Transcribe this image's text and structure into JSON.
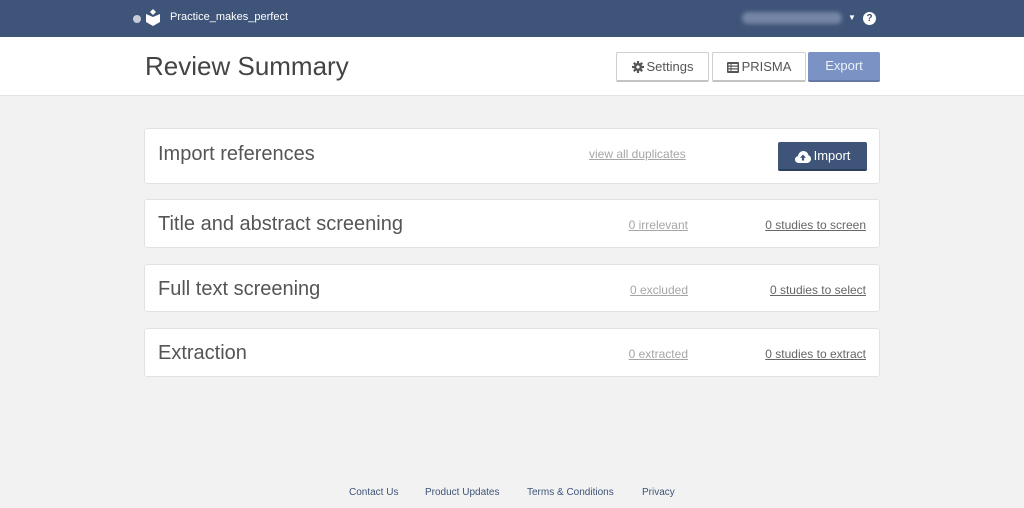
{
  "topbar": {
    "project_name": "Practice_makes_perfect",
    "user_name": "(blurred)",
    "help_label": "?"
  },
  "header": {
    "title": "Review Summary",
    "settings_label": "Settings",
    "prisma_label": "PRISMA",
    "export_label": "Export"
  },
  "stages": {
    "import": {
      "title": "Import references",
      "duplicates_link": "view all duplicates",
      "import_label": "Import"
    },
    "title_abstract": {
      "title": "Title and abstract screening",
      "muted_link": "0 irrelevant",
      "main_link": "0 studies to screen"
    },
    "full_text": {
      "title": "Full text screening",
      "muted_link": "0 excluded",
      "main_link": "0 studies to select"
    },
    "extraction": {
      "title": "Extraction",
      "muted_link": "0 extracted",
      "main_link": "0 studies to extract"
    }
  },
  "footer": {
    "links": [
      "Contact Us",
      "Product Updates",
      "Terms & Conditions",
      "Privacy"
    ]
  },
  "colors": {
    "brand": "#3e5478",
    "export_button": "#7b93c4",
    "background": "#f2f2f2"
  }
}
